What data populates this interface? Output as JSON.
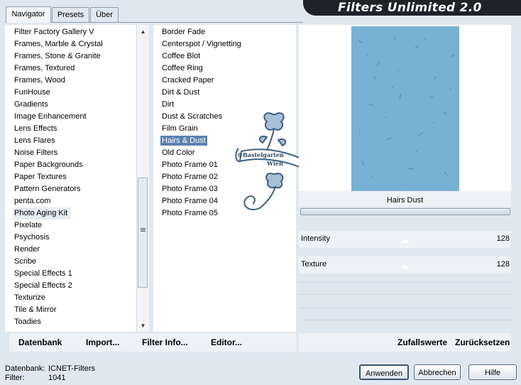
{
  "app": {
    "title": "Filters Unlimited 2.0"
  },
  "tabs": [
    {
      "label": "Navigator"
    },
    {
      "label": "Presets"
    },
    {
      "label": "Über"
    }
  ],
  "categories": [
    "Filter Factory Gallery V",
    "Frames, Marble & Crystal",
    "Frames, Stone & Granite",
    "Frames, Textured",
    "Frames, Wood",
    "FunHouse",
    "Gradients",
    "Image Enhancement",
    "Lens Effects",
    "Lens Flares",
    "Noise Filters",
    "Paper Backgrounds",
    "Paper Textures",
    "Pattern Generators",
    "penta.com",
    "Photo Aging Kit",
    "Pixelate",
    "Psychosis",
    "Render",
    "Scribe",
    "Special Effects 1",
    "Special Effects 2",
    "Texturize",
    "Tile & Mirror",
    "Toadies"
  ],
  "selected_category": "Photo Aging Kit",
  "filters": [
    "Border Fade",
    "Centerspot / Vignetting",
    "Coffee Blot",
    "Coffee Ring",
    "Cracked Paper",
    "Dirt & Dust",
    "Dirt",
    "Dust & Scratches",
    "Film Grain",
    "Hairs & Dust",
    "Old Color",
    "Photo Frame 01",
    "Photo Frame 02",
    "Photo Frame 03",
    "Photo Frame 04",
    "Photo Frame 05"
  ],
  "selected_filter": "Hairs & Dust",
  "watermark": {
    "text_line1": "©Bastelgarten",
    "text_line2": "Wien"
  },
  "toolbar": {
    "datenbank": "Datenbank",
    "import": "Import...",
    "filter_info": "Filter Info...",
    "editor": "Editor..."
  },
  "preview": {
    "filter_name": "Hairs  Dust",
    "color": "#77b1d4"
  },
  "params": [
    {
      "label": "Intensity",
      "value": "128"
    },
    {
      "label": "Texture",
      "value": "128"
    }
  ],
  "right_toolbar": {
    "random": "Zufallswerte",
    "reset": "Zurücksetzen"
  },
  "status": {
    "db_label": "Datenbank:",
    "db_value": "ICNET-Filters",
    "filter_label": "Filter:",
    "filter_value": "1041"
  },
  "buttons": {
    "apply": "Anwenden",
    "cancel": "Abbrechen",
    "help": "Hilfe"
  },
  "colors": {
    "accent": "#5b82b0",
    "banner": "#1e2328",
    "background": "#dfe8f1"
  }
}
